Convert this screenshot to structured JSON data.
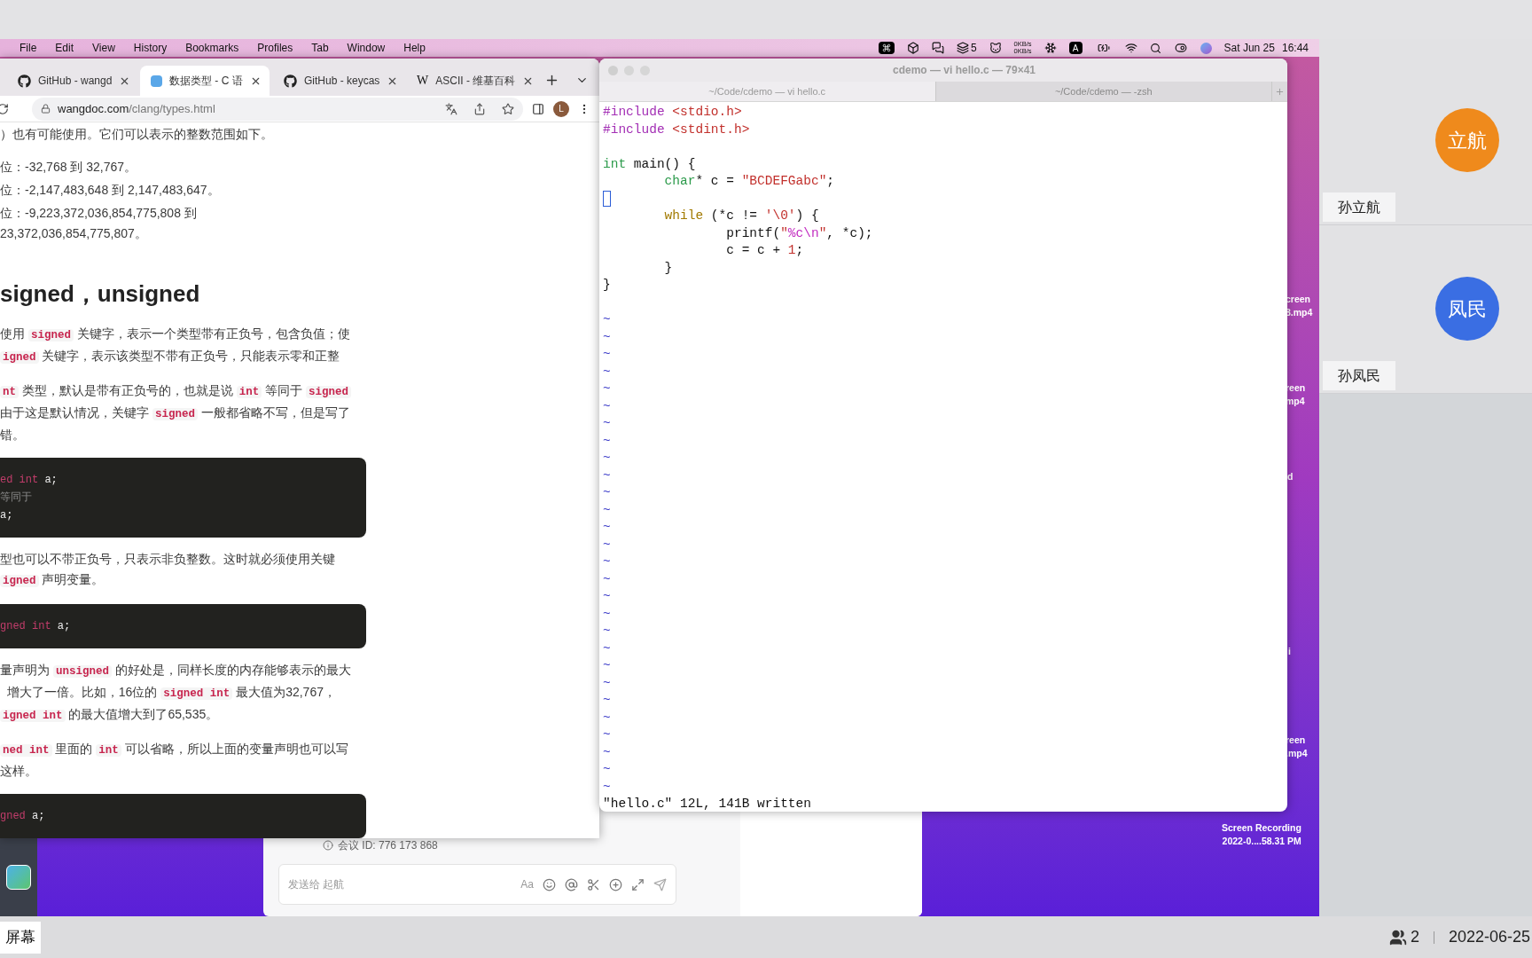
{
  "menu_bar": {
    "items": [
      "File",
      "Edit",
      "View",
      "History",
      "Bookmarks",
      "Profiles",
      "Tab",
      "Window",
      "Help"
    ],
    "status": {
      "badge_count": "5",
      "net_up": "0KB/s",
      "net_down": "0KB/s",
      "input_method": "A",
      "date": "Sat Jun 25",
      "time": "16:44"
    }
  },
  "browser": {
    "tabs": [
      {
        "label": "GitHub - wangd",
        "kind": "github",
        "selected": false
      },
      {
        "label": "数据类型 - C 语",
        "kind": "doc",
        "selected": true
      },
      {
        "label": "GitHub - keycas",
        "kind": "github",
        "selected": false
      },
      {
        "label": "ASCII - 维基百科",
        "kind": "wiki",
        "icon_text": "W",
        "selected": false
      }
    ],
    "url_host": "wangdoc.com",
    "url_path": "/clang/types.html",
    "profile_initial": "L",
    "content": [
      {
        "kind": "p",
        "lines": [
          [
            {
              "kind": "text",
              "text": "）也有可能使用。它们可以表示的整数范围如下。"
            }
          ]
        ]
      },
      {
        "kind": "li",
        "lines": [
          [
            {
              "kind": "text",
              "text": "位：-32,768 到 32,767。"
            }
          ]
        ]
      },
      {
        "kind": "li",
        "lines": [
          [
            {
              "kind": "text",
              "text": "位：-2,147,483,648 到 2,147,483,647。"
            }
          ]
        ]
      },
      {
        "kind": "li",
        "lines": [
          [
            {
              "kind": "text",
              "text": "位：-9,223,372,036,854,775,808 到"
            }
          ],
          [
            {
              "kind": "text",
              "text": "23,372,036,854,775,807。"
            }
          ]
        ]
      },
      {
        "kind": "h2",
        "text": "signed，unsigned"
      },
      {
        "kind": "p",
        "lines": [
          [
            {
              "kind": "text",
              "text": "使用 "
            },
            {
              "kind": "code",
              "text": "signed"
            },
            {
              "kind": "text",
              "text": " 关键字，表示一个类型带有正负号，包含负值；使"
            }
          ],
          [
            {
              "kind": "code",
              "text": "igned"
            },
            {
              "kind": "text",
              "text": " 关键字，表示该类型不带有正负号，只能表示零和正整"
            }
          ]
        ]
      },
      {
        "kind": "p",
        "lines": [
          [
            {
              "kind": "code",
              "text": "nt"
            },
            {
              "kind": "text",
              "text": " 类型，默认是带有正负号的，也就是说 "
            },
            {
              "kind": "code",
              "text": "int"
            },
            {
              "kind": "text",
              "text": " 等同于 "
            },
            {
              "kind": "code",
              "text": "signed"
            }
          ],
          [
            {
              "kind": "text",
              "text": "由于这是默认情况，关键字 "
            },
            {
              "kind": "code",
              "text": "signed"
            },
            {
              "kind": "text",
              "text": " 一般都省略不写，但是写了"
            }
          ],
          [
            {
              "kind": "text",
              "text": "错。"
            }
          ]
        ]
      },
      {
        "kind": "code",
        "lines": [
          [
            {
              "kind": "keyword",
              "text": "ed int"
            },
            {
              "kind": "plain",
              "text": " a;"
            }
          ],
          [
            {
              "kind": "comment",
              "text": "等同于"
            }
          ],
          [
            {
              "kind": "plain",
              "text": "a;"
            }
          ]
        ]
      },
      {
        "kind": "p",
        "lines": [
          [
            {
              "kind": "text",
              "text": "型也可以不带正负号，只表示非负整数。这时就必须使用关键"
            }
          ],
          [
            {
              "kind": "code",
              "text": "igned"
            },
            {
              "kind": "text",
              "text": " 声明变量。"
            }
          ]
        ]
      },
      {
        "kind": "code",
        "lines": [
          [
            {
              "kind": "keyword",
              "text": "gned int"
            },
            {
              "kind": "plain",
              "text": " a;"
            }
          ]
        ]
      },
      {
        "kind": "p",
        "lines": [
          [
            {
              "kind": "text",
              "text": "量声明为 "
            },
            {
              "kind": "code",
              "text": "unsigned"
            },
            {
              "kind": "text",
              "text": " 的好处是，同样长度的内存能够表示的最大"
            }
          ],
          [
            {
              "kind": "text",
              "text": "  增大了一倍。比如，16位的 "
            },
            {
              "kind": "code",
              "text": "signed int"
            },
            {
              "kind": "text",
              "text": " 最大值为32,767，"
            }
          ],
          [
            {
              "kind": "code",
              "text": "igned int"
            },
            {
              "kind": "text",
              "text": " 的最大值增大到了65,535。"
            }
          ]
        ]
      },
      {
        "kind": "p",
        "lines": [
          [
            {
              "kind": "code",
              "text": "ned int"
            },
            {
              "kind": "text",
              "text": " 里面的 "
            },
            {
              "kind": "code",
              "text": "int"
            },
            {
              "kind": "text",
              "text": " 可以省略，所以上面的变量声明也可以写"
            }
          ],
          [
            {
              "kind": "text",
              "text": "这样。"
            }
          ]
        ]
      },
      {
        "kind": "code",
        "lines": [
          [
            {
              "kind": "keyword",
              "text": "gned"
            },
            {
              "kind": "plain",
              "text": " a;"
            }
          ]
        ]
      }
    ]
  },
  "terminal": {
    "title": "cdemo — vi hello.c — 79×41",
    "tabs": [
      {
        "label": "~/Code/cdemo — vi hello.c",
        "selected": true
      },
      {
        "label": "~/Code/cdemo — -zsh",
        "selected": false
      }
    ],
    "lines": [
      {
        "kind": "code",
        "tokens": [
          {
            "kind": "preproc",
            "text": "#include "
          },
          {
            "kind": "string",
            "text": "<stdio.h>"
          }
        ]
      },
      {
        "kind": "code",
        "tokens": [
          {
            "kind": "preproc",
            "text": "#include "
          },
          {
            "kind": "string",
            "text": "<stdint.h>"
          }
        ]
      },
      {
        "kind": "blank"
      },
      {
        "kind": "code",
        "tokens": [
          {
            "kind": "type",
            "text": "int"
          },
          {
            "kind": "plain",
            "text": " main() {"
          }
        ]
      },
      {
        "kind": "code",
        "tokens": [
          {
            "kind": "type",
            "text": "        char"
          },
          {
            "kind": "plain",
            "text": "* c = "
          },
          {
            "kind": "string",
            "text": "\"BCDEFGabc\""
          },
          {
            "kind": "plain",
            "text": ";"
          }
        ]
      },
      {
        "kind": "cursor"
      },
      {
        "kind": "code",
        "tokens": [
          {
            "kind": "statement",
            "text": "        while"
          },
          {
            "kind": "plain",
            "text": " (*c != "
          },
          {
            "kind": "string",
            "text": "'\\0'"
          },
          {
            "kind": "plain",
            "text": ") {"
          }
        ]
      },
      {
        "kind": "code",
        "tokens": [
          {
            "kind": "plain",
            "text": "                printf("
          },
          {
            "kind": "string",
            "text": "\""
          },
          {
            "kind": "special",
            "text": "%c\\n"
          },
          {
            "kind": "string",
            "text": "\""
          },
          {
            "kind": "plain",
            "text": ", *c);"
          }
        ]
      },
      {
        "kind": "code",
        "tokens": [
          {
            "kind": "plain",
            "text": "                c = c + "
          },
          {
            "kind": "number",
            "text": "1"
          },
          {
            "kind": "plain",
            "text": ";"
          }
        ]
      },
      {
        "kind": "code",
        "tokens": [
          {
            "kind": "plain",
            "text": "        }"
          }
        ]
      },
      {
        "kind": "code",
        "tokens": [
          {
            "kind": "plain",
            "text": "}"
          }
        ]
      },
      {
        "kind": "blank"
      }
    ],
    "tildes": [
      "~",
      "~",
      "~",
      "~",
      "~",
      "~",
      "~",
      "~",
      "~",
      "~",
      "~",
      "~",
      "~",
      "~",
      "~",
      "~",
      "~",
      "~",
      "~",
      "~",
      "~",
      "~",
      "~",
      "~",
      "~",
      "~",
      "~",
      "~"
    ],
    "status": "\"hello.c\" 12L, 141B written"
  },
  "desktop_files": [
    {
      "lines": [
        "creen",
        "8.mp4"
      ]
    },
    {
      "lines": [
        "reen",
        "mp4"
      ]
    },
    {
      "lines": [
        "d"
      ]
    },
    {
      "lines": [
        "i"
      ]
    },
    {
      "lines": [
        "reen",
        ".mp4"
      ]
    },
    {
      "lines": [
        "Screen Recording",
        "2022-0....58.31 PM"
      ]
    }
  ],
  "meeting_window": {
    "meeting_id": "会议 ID: 776 173 868",
    "message_placeholder": "发送给 起航",
    "font_button": "Aa"
  },
  "participants": [
    {
      "avatar": "立航",
      "name": "孙立航",
      "color": "#ef8a1c"
    },
    {
      "avatar": "凤民",
      "name": "孙凤民",
      "color": "#3a6ee3"
    }
  ],
  "bottom_bar": {
    "screen_label": "屏幕",
    "participant_count": "2",
    "date": "2022-06-25"
  }
}
